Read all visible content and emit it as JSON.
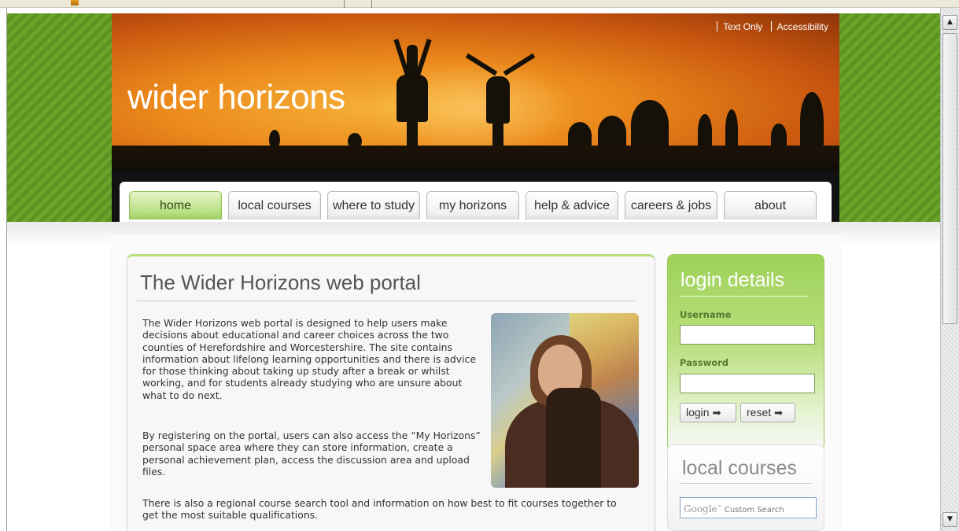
{
  "header": {
    "site_name": "wider horizons",
    "top_links": [
      "Text Only",
      "Accessibility"
    ]
  },
  "nav": {
    "tabs": [
      {
        "label": "home",
        "active": true
      },
      {
        "label": "local courses",
        "active": false
      },
      {
        "label": "where to study",
        "active": false
      },
      {
        "label": "my horizons",
        "active": false
      },
      {
        "label": "help & advice",
        "active": false
      },
      {
        "label": "careers & jobs",
        "active": false
      },
      {
        "label": "about",
        "active": false
      }
    ]
  },
  "main": {
    "title": "The Wider Horizons web portal",
    "paragraphs": [
      "The Wider Horizons web portal is designed to help users make decisions about educational and career choices across the two counties of Herefordshire and Worcestershire. The site contains information about lifelong learning opportunities and there is advice for those thinking about taking up study after a break or whilst working, and for students already studying who are unsure about what to do next.",
      "By registering on the portal, users can also access the “My Horizons” personal space area where they can store information, create a personal achievement plan, access the discussion area and upload files.",
      "There is also a regional course search tool and information on how best to fit courses together to get the most suitable qualifications."
    ]
  },
  "login": {
    "title": "login details",
    "username_label": "Username",
    "password_label": "Password",
    "username_value": "",
    "password_value": "",
    "login_button": "login",
    "reset_button": "reset"
  },
  "courses": {
    "title": "local courses",
    "search_brand": "Google",
    "search_placeholder": "Custom Search"
  },
  "colors": {
    "accent_green": "#9ed25a",
    "stripe_green": "#6aa52a",
    "sky_orange": "#ec8a1c"
  }
}
